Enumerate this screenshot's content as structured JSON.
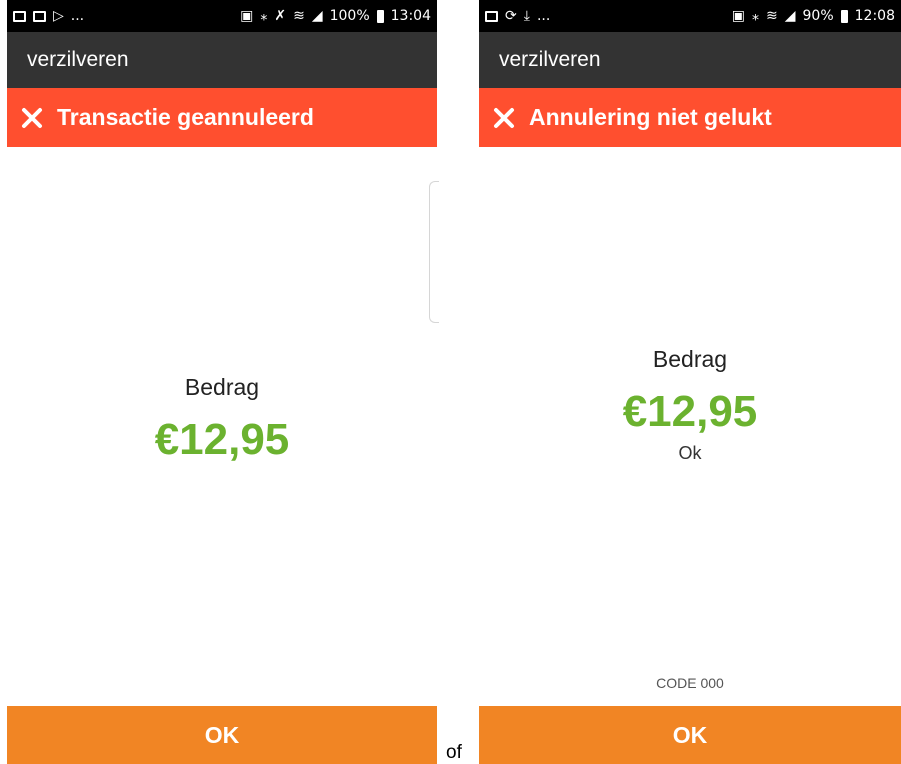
{
  "screens": [
    {
      "status_bar": {
        "left_icons": [
          "image-icon",
          "mail-icon",
          "play-store-icon"
        ],
        "left_more": "...",
        "right_icons": [
          "nfc-icon",
          "bluetooth-icon",
          "mute-icon",
          "wifi-icon",
          "signal-icon"
        ],
        "battery": "100%",
        "time": "13:04"
      },
      "app_title": "verzilveren",
      "error_message": "Transactie geannuleerd",
      "amount_label": "Bedrag",
      "amount": "€12,95",
      "ok_button": "OK"
    },
    {
      "status_bar": {
        "left_icons": [
          "image-icon",
          "sync-icon",
          "download-icon"
        ],
        "left_more": "...",
        "right_icons": [
          "nfc-icon",
          "bluetooth-icon",
          "wifi-icon",
          "signal-icon"
        ],
        "battery": "90%",
        "time": "12:08"
      },
      "app_title": "verzilveren",
      "error_message": "Annulering niet gelukt",
      "amount_label": "Bedrag",
      "amount": "€12,95",
      "status": "Ok",
      "code": "CODE 000",
      "ok_button": "OK"
    }
  ],
  "separator": "of",
  "colors": {
    "status_bar": "#000000",
    "app_bar": "#333333",
    "error_bar": "#ff4f2f",
    "amount": "#6bb22f",
    "ok_button": "#f18524"
  }
}
